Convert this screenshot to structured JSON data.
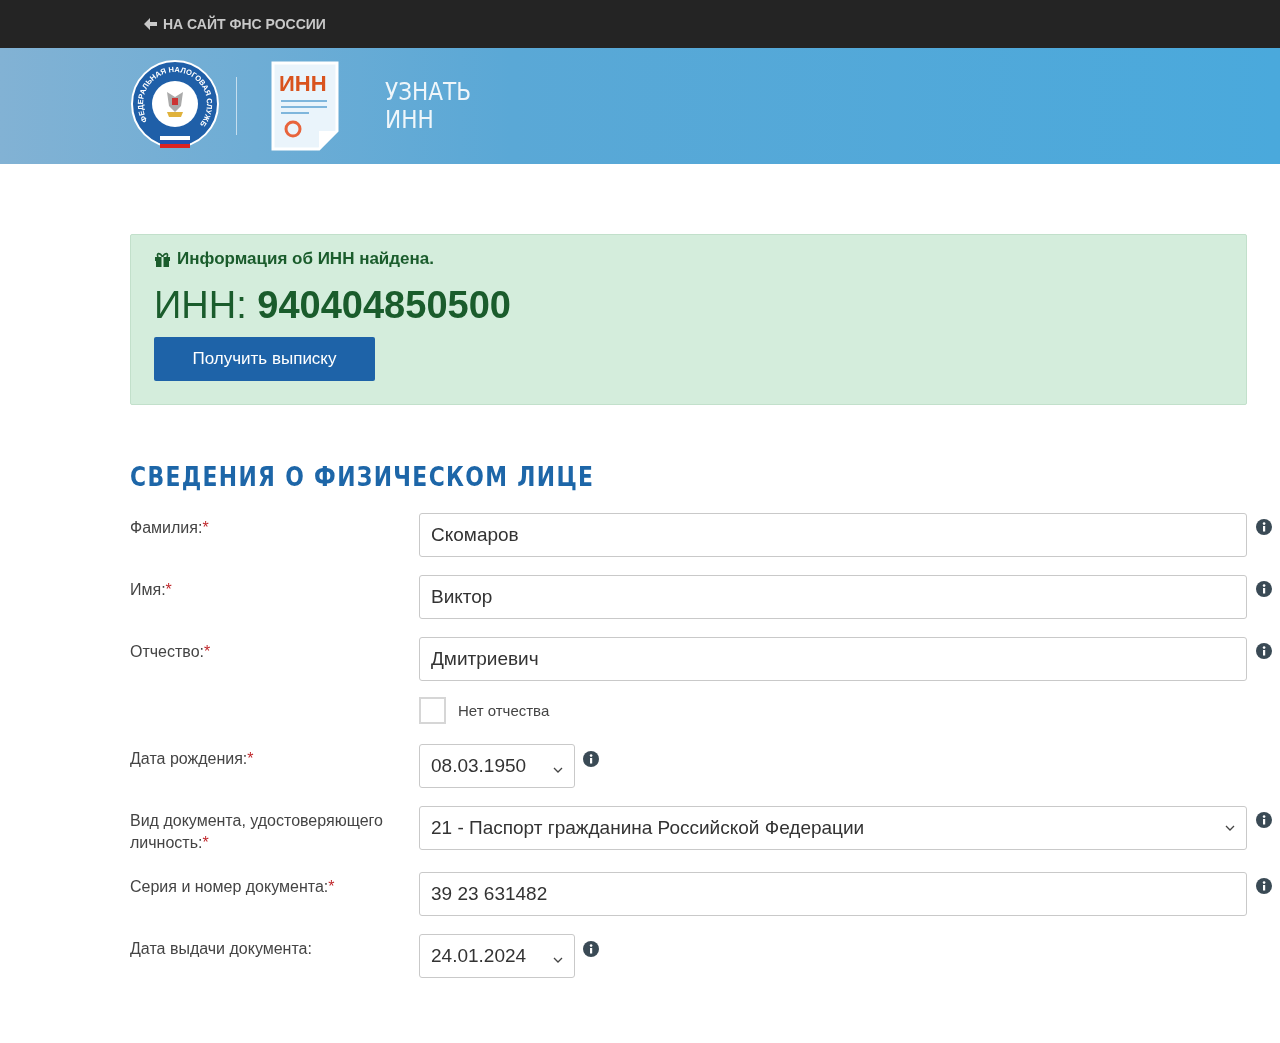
{
  "top_bar": {
    "back_link": "НА САЙТ ФНС РОССИИ"
  },
  "banner": {
    "emblem_text": "ФЕДЕРАЛЬНАЯ НАЛОГОВАЯ СЛУЖБА",
    "document_icon_text": "ИНН",
    "title_lines": [
      "УЗНАТЬ",
      "ИНН"
    ]
  },
  "result": {
    "message": "Информация об ИНН найдена.",
    "inn_label": "ИНН:",
    "inn_value": "940404850500",
    "button": "Получить выписку"
  },
  "section_title": "СВЕДЕНИЯ О ФИЗИЧЕСКОМ ЛИЦЕ",
  "fields": [
    {
      "kind": "text",
      "label": "Фамилия:",
      "required_mark": "*",
      "value": "Скомаров"
    },
    {
      "kind": "text",
      "label": "Имя:",
      "required_mark": "*",
      "value": "Виктор"
    },
    {
      "kind": "text",
      "label": "Отчество:",
      "required_mark": "*",
      "value": "Дмитриевич"
    },
    {
      "kind": "checkbox",
      "label": "Нет отчества",
      "checked": false
    },
    {
      "kind": "date",
      "label": "Дата рождения:",
      "required_mark": "*",
      "value": "08.03.1950"
    },
    {
      "kind": "select",
      "label": "Вид документа, удостоверяющего личность:",
      "required_mark": "*",
      "value": "21 - Паспорт гражданина Российской Федерации"
    },
    {
      "kind": "text",
      "label": "Серия и номер документа:",
      "required_mark": "*",
      "value": "39 23 631482"
    },
    {
      "kind": "date",
      "label": "Дата выдачи документа:",
      "value": "24.01.2024"
    }
  ]
}
